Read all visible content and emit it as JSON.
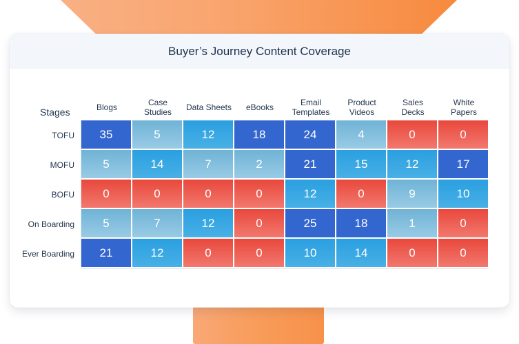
{
  "chart_data": {
    "type": "heatmap",
    "title": "Buyer’s Journey Content Coverage",
    "ylabel": "Stages",
    "xlabel": "",
    "columns": [
      "Blogs",
      "Case\nStudies",
      "Data Sheets",
      "eBooks",
      "Email\nTemplates",
      "Product\nVideos",
      "Sales\nDecks",
      "White\nPapers"
    ],
    "rows": [
      "TOFU",
      "MOFU",
      "BOFU",
      "On Boarding",
      "Ever Boarding"
    ],
    "values": [
      [
        35,
        5,
        12,
        18,
        24,
        4,
        0,
        0
      ],
      [
        5,
        14,
        7,
        2,
        21,
        15,
        12,
        17
      ],
      [
        0,
        0,
        0,
        0,
        12,
        0,
        9,
        10
      ],
      [
        5,
        7,
        12,
        0,
        25,
        18,
        1,
        0
      ],
      [
        21,
        12,
        0,
        0,
        10,
        14,
        0,
        0
      ]
    ],
    "color_scale": {
      "zero": {
        "top": "#e9483c",
        "bottom": "#f2786e"
      },
      "low": {
        "top": "#6fb3d6",
        "bottom": "#98cbe5"
      },
      "mid": {
        "top": "#2a9fe0",
        "bottom": "#48b0e6"
      },
      "high": {
        "top": "#3366cf",
        "bottom": "#3366cf"
      }
    },
    "legend": "none"
  }
}
